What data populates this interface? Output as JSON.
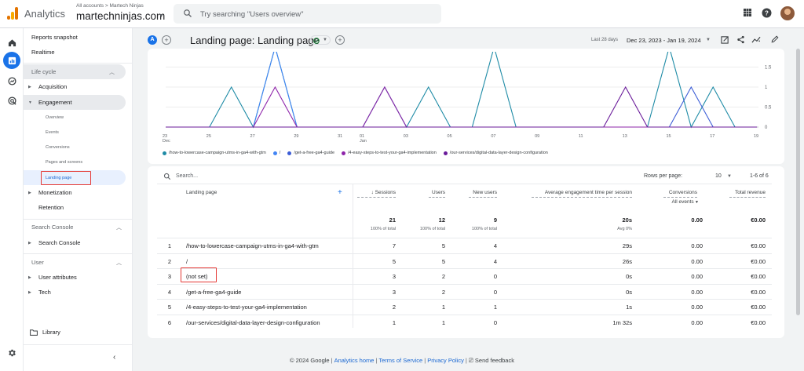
{
  "topbar": {
    "app_name": "Analytics",
    "account_crumb": "All accounts > Martech Ninjas",
    "property_name": "martechninjas.com",
    "search_placeholder": "Try searching \"Users overview\""
  },
  "sidebar": {
    "reports_snapshot": "Reports snapshot",
    "realtime": "Realtime",
    "lifecycle": "Life cycle",
    "acquisition": "Acquisition",
    "engagement": "Engagement",
    "overview": "Overview",
    "events": "Events",
    "conversions": "Conversions",
    "pages_screens": "Pages and screens",
    "landing_page": "Landing page",
    "monetization": "Monetization",
    "retention": "Retention",
    "search_console_section": "Search Console",
    "search_console": "Search Console",
    "user_section": "User",
    "user_attributes": "User attributes",
    "tech": "Tech",
    "library": "Library"
  },
  "header": {
    "segment_badge": "A",
    "title": "Landing page: Landing page",
    "date_label": "Last 28 days",
    "date_range": "Dec 23, 2023 - Jan 19, 2024"
  },
  "chart_data": {
    "type": "line",
    "x": [
      "23 Dec",
      "24",
      "25",
      "26",
      "27",
      "28",
      "29",
      "30",
      "31",
      "01 Jan",
      "02",
      "03",
      "04",
      "05",
      "06",
      "07",
      "08",
      "09",
      "10",
      "11",
      "12",
      "13",
      "14",
      "15",
      "16",
      "17",
      "18",
      "19"
    ],
    "x_tick_labels": [
      "23",
      "Dec",
      "25",
      "27",
      "29",
      "31",
      "01",
      "Jan",
      "03",
      "05",
      "07",
      "09",
      "11",
      "13",
      "15",
      "17",
      "19"
    ],
    "y_tick_labels": [
      "0",
      "0.5",
      "1",
      "1.5"
    ],
    "ylim": [
      0,
      1.5
    ],
    "series": [
      {
        "name": "/how-to-lowercase-campaign-utms-in-ga4-with-gtm",
        "color": "#1e8ba6",
        "values": [
          0,
          0,
          0,
          1,
          0,
          2,
          0,
          0,
          0,
          0,
          1,
          0,
          1,
          0,
          0,
          2,
          0,
          0,
          0,
          0,
          0,
          0,
          0,
          2,
          0,
          1,
          0,
          0
        ]
      },
      {
        "name": "/",
        "color": "#4285f4",
        "values": [
          0,
          0,
          0,
          0,
          0,
          2,
          0,
          0,
          0,
          0,
          0,
          0,
          0,
          0,
          0,
          0,
          0,
          0,
          0,
          0,
          0,
          0,
          0,
          0,
          0,
          0,
          0,
          0
        ]
      },
      {
        "name": "/get-a-free-ga4-guide",
        "color": "#3c5dd6",
        "values": [
          0,
          0,
          0,
          0,
          0,
          0,
          0,
          0,
          0,
          0,
          0,
          0,
          0,
          0,
          0,
          0,
          0,
          0,
          0,
          0,
          0,
          0,
          0,
          0,
          1,
          0,
          0,
          0
        ]
      },
      {
        "name": "/4-easy-steps-to-test-your-ga4-implementation",
        "color": "#8e24aa",
        "values": [
          0,
          0,
          0,
          0,
          0,
          1,
          0,
          0,
          0,
          0,
          1,
          0,
          0,
          0,
          0,
          0,
          0,
          0,
          0,
          0,
          0,
          0,
          0,
          0,
          0,
          0,
          0,
          0
        ]
      },
      {
        "name": "/our-services/digital-data-layer-design-configuration",
        "color": "#6a1b9a",
        "values": [
          0,
          0,
          0,
          0,
          0,
          0,
          0,
          0,
          0,
          0,
          0,
          0,
          0,
          0,
          0,
          0,
          0,
          0,
          0,
          0,
          0,
          1,
          0,
          0,
          0,
          0,
          0,
          0
        ]
      }
    ]
  },
  "table": {
    "search_placeholder": "Search...",
    "rows_per_page_label": "Rows per page:",
    "rows_per_page": "10",
    "range": "1-6 of 6",
    "columns": {
      "landing_page": "Landing page",
      "sessions": "Sessions",
      "users": "Users",
      "new_users": "New users",
      "avg_engagement": "Average engagement time per session",
      "conversions": "Conversions",
      "conversions_filter": "All events",
      "total_revenue": "Total revenue"
    },
    "totals": {
      "sessions": "21",
      "sessions_sub": "100% of total",
      "users": "12",
      "users_sub": "100% of total",
      "new_users": "9",
      "new_users_sub": "100% of total",
      "avg_engagement": "20s",
      "avg_engagement_sub": "Avg 0%",
      "conversions": "0.00",
      "total_revenue": "€0.00"
    },
    "rows": [
      {
        "idx": "1",
        "page": "/how-to-lowercase-campaign-utms-in-ga4-with-gtm",
        "sessions": "7",
        "users": "5",
        "new_users": "4",
        "avg": "29s",
        "conv": "0.00",
        "rev": "€0.00"
      },
      {
        "idx": "2",
        "page": "/",
        "sessions": "5",
        "users": "5",
        "new_users": "4",
        "avg": "26s",
        "conv": "0.00",
        "rev": "€0.00"
      },
      {
        "idx": "3",
        "page": "(not set)",
        "sessions": "3",
        "users": "2",
        "new_users": "0",
        "avg": "0s",
        "conv": "0.00",
        "rev": "€0.00"
      },
      {
        "idx": "4",
        "page": "/get-a-free-ga4-guide",
        "sessions": "3",
        "users": "2",
        "new_users": "0",
        "avg": "0s",
        "conv": "0.00",
        "rev": "€0.00"
      },
      {
        "idx": "5",
        "page": "/4-easy-steps-to-test-your-ga4-implementation",
        "sessions": "2",
        "users": "1",
        "new_users": "1",
        "avg": "1s",
        "conv": "0.00",
        "rev": "€0.00"
      },
      {
        "idx": "6",
        "page": "/our-services/digital-data-layer-design-configuration",
        "sessions": "1",
        "users": "1",
        "new_users": "0",
        "avg": "1m 32s",
        "conv": "0.00",
        "rev": "€0.00"
      }
    ]
  },
  "footer": {
    "copyright": "© 2024 Google",
    "analytics_home": "Analytics home",
    "terms": "Terms of Service",
    "privacy": "Privacy Policy",
    "feedback": "Send feedback"
  }
}
